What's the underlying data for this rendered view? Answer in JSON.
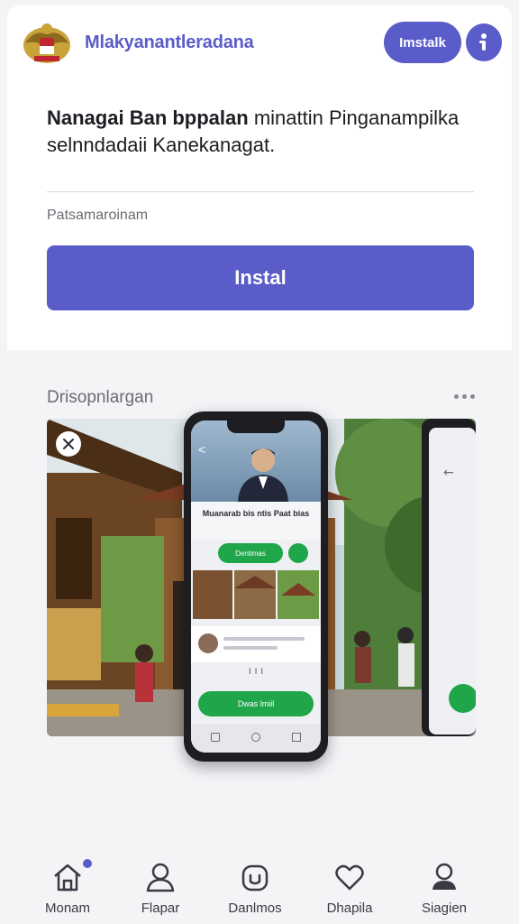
{
  "header": {
    "app_name": "Mlakyanantleradana",
    "install_pill_label": "Imstalk",
    "logo_icon": "garuda-emblem-icon",
    "info_icon": "info-person-icon"
  },
  "hero": {
    "headline_bold": "Nanagai Ban bppalan",
    "headline_rest": " minattin Pinganampilka selnndadaii Kanekanagat."
  },
  "details": {
    "sublabel": "Patsamaroinam",
    "install_button_label": "Instal"
  },
  "gallery": {
    "section_title": "Drisopnlargan",
    "more_icon": "more-dots-icon",
    "close_icon": "close-icon",
    "phone": {
      "title": "Muanarab bis ntis Paat bias",
      "chip_label": "Dentimas",
      "dots_text": "ı  ı  ı",
      "green_button_label": "Dwas lmiil"
    }
  },
  "bottom_nav": [
    {
      "label": "Monam",
      "icon": "home-icon"
    },
    {
      "label": "Flapar",
      "icon": "person-icon"
    },
    {
      "label": "Danlmos",
      "icon": "camera-icon"
    },
    {
      "label": "Dhapila",
      "icon": "heart-icon"
    },
    {
      "label": "Siagien",
      "icon": "profile-icon"
    }
  ],
  "colors": {
    "accent": "#5a5cc9",
    "green": "#1fa54a",
    "background": "#f4f4f7"
  }
}
